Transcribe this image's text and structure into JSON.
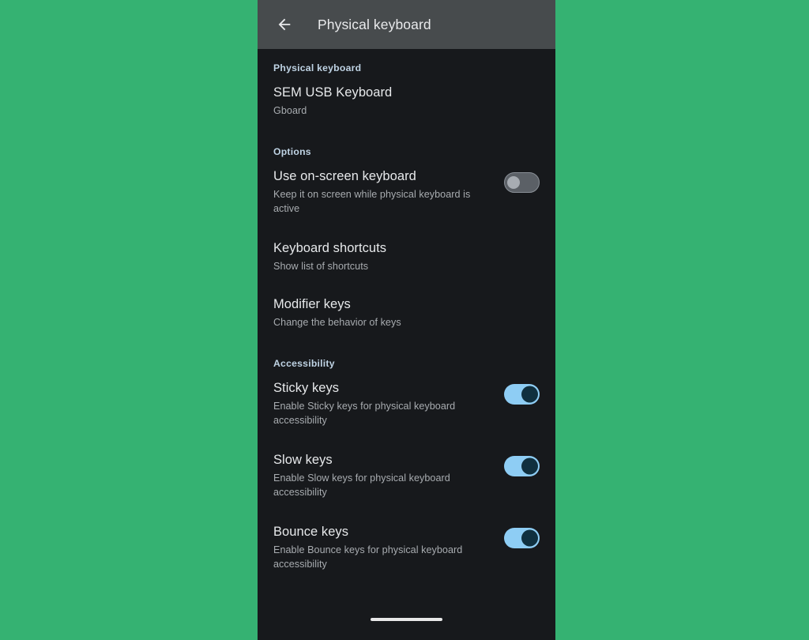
{
  "backdrop": {
    "color": "#35b272"
  },
  "appbar": {
    "title": "Physical keyboard",
    "back_icon": "arrow-back-icon",
    "background": "#474b4d"
  },
  "sections": [
    {
      "header": "Physical keyboard",
      "rows": [
        {
          "title": "SEM USB Keyboard",
          "subtitle": "Gboard",
          "control": "none"
        }
      ]
    },
    {
      "header": "Options",
      "rows": [
        {
          "title": "Use on-screen keyboard",
          "subtitle": "Keep it on screen while physical keyboard is active",
          "control": "switch",
          "switch_state": "off"
        },
        {
          "title": "Keyboard shortcuts",
          "subtitle": "Show list of shortcuts",
          "control": "none"
        },
        {
          "title": "Modifier keys",
          "subtitle": "Change the behavior of keys",
          "control": "none"
        }
      ]
    },
    {
      "header": "Accessibility",
      "rows": [
        {
          "title": "Sticky keys",
          "subtitle": "Enable Sticky keys for physical keyboard accessibility",
          "control": "switch",
          "switch_state": "on"
        },
        {
          "title": "Slow keys",
          "subtitle": "Enable Slow keys for physical keyboard accessibility",
          "control": "switch",
          "switch_state": "on"
        },
        {
          "title": "Bounce keys",
          "subtitle": "Enable Bounce keys for physical keyboard accessibility",
          "control": "switch",
          "switch_state": "on"
        }
      ]
    }
  ],
  "nav_bar": {
    "handle": "home-gesture-handle"
  },
  "colors": {
    "surface": "#17191c",
    "appbar": "#474b4d",
    "accent_on": "#8ecdf4",
    "accent_thumb": "#10303f",
    "section_header": "#bfd3e4",
    "primary_text": "#e7e9eb",
    "secondary_text": "#a8acb0",
    "backdrop_green": "#35b272"
  }
}
